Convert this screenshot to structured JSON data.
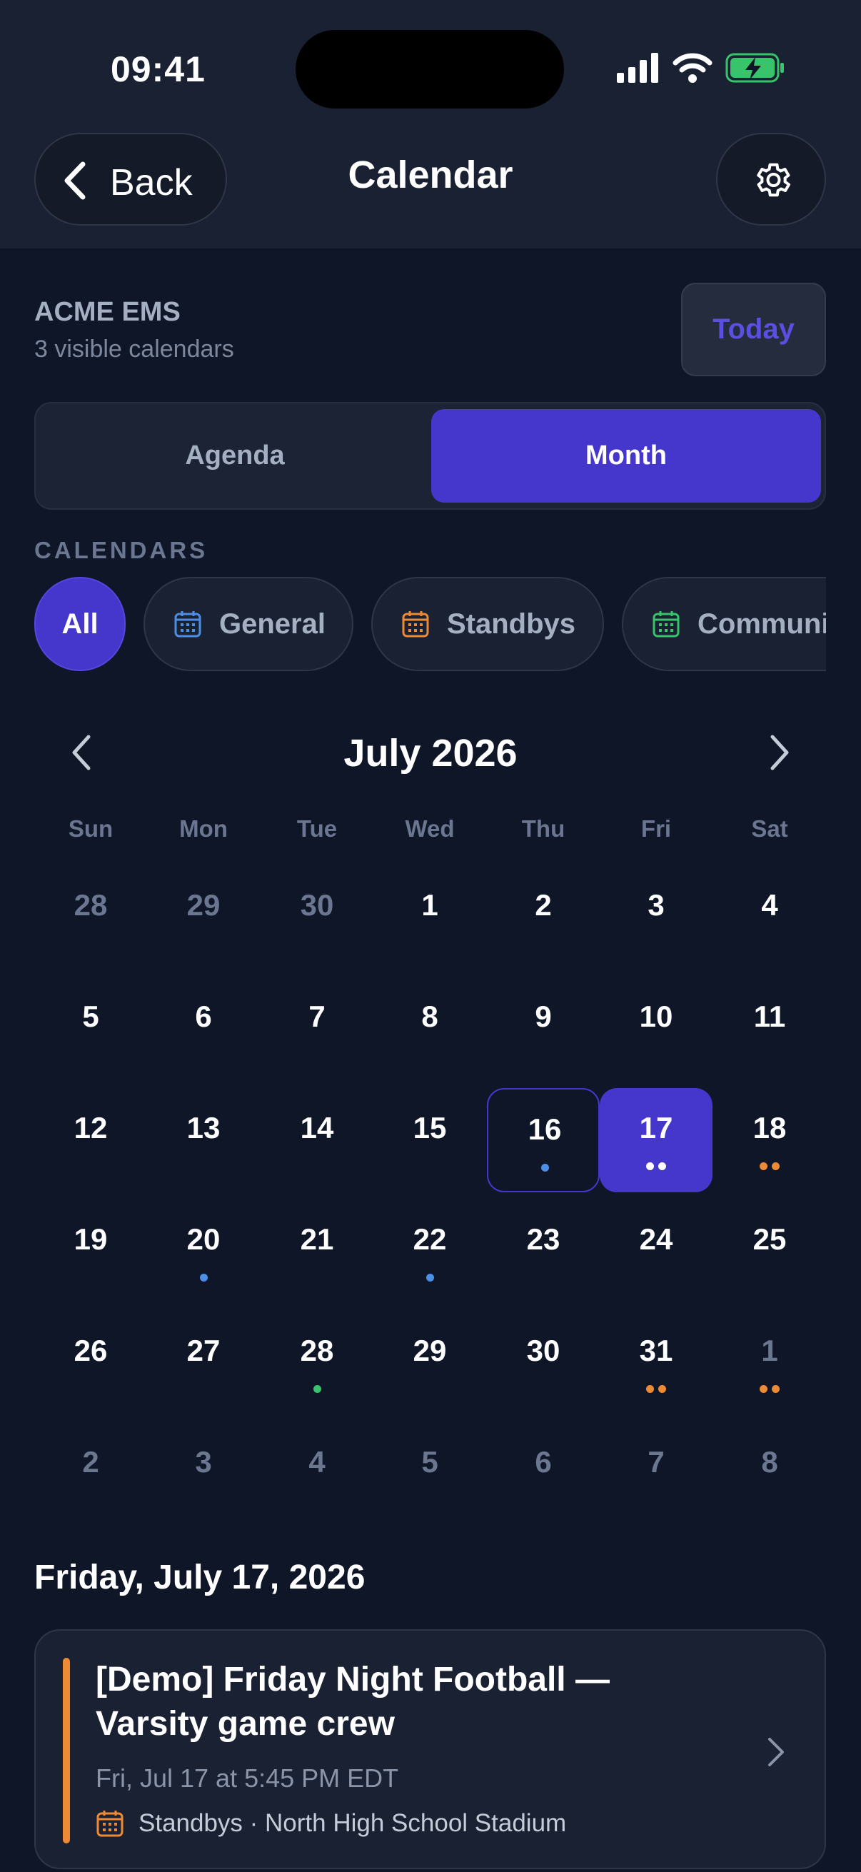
{
  "status": {
    "time": "09:41"
  },
  "nav": {
    "back_label": "Back",
    "title": "Calendar"
  },
  "org": {
    "name": "ACME EMS",
    "subtitle": "3 visible calendars",
    "today_label": "Today"
  },
  "segments": {
    "agenda": "Agenda",
    "month": "Month",
    "selected": "Month"
  },
  "calendars": {
    "heading": "CALENDARS",
    "chips": [
      {
        "label": "All",
        "selected": true
      },
      {
        "label": "General",
        "color": "#4e8fe6",
        "icon": "calendar-icon"
      },
      {
        "label": "Standbys",
        "color": "#ed8a35",
        "icon": "calendar-icon"
      },
      {
        "label": "Community",
        "color": "#38c46a",
        "icon": "calendar-icon"
      }
    ]
  },
  "month": {
    "title": "July 2026",
    "weekdays": [
      "Sun",
      "Mon",
      "Tue",
      "Wed",
      "Thu",
      "Fri",
      "Sat"
    ],
    "weeks": [
      [
        {
          "d": "28",
          "m": true
        },
        {
          "d": "29",
          "m": true
        },
        {
          "d": "30",
          "m": true
        },
        {
          "d": "1"
        },
        {
          "d": "2"
        },
        {
          "d": "3"
        },
        {
          "d": "4"
        }
      ],
      [
        {
          "d": "5"
        },
        {
          "d": "6"
        },
        {
          "d": "7"
        },
        {
          "d": "8"
        },
        {
          "d": "9"
        },
        {
          "d": "10"
        },
        {
          "d": "11"
        }
      ],
      [
        {
          "d": "12"
        },
        {
          "d": "13"
        },
        {
          "d": "14"
        },
        {
          "d": "15"
        },
        {
          "d": "16",
          "today": true,
          "dots": [
            "#4e8fe6"
          ]
        },
        {
          "d": "17",
          "selected": true,
          "dots": [
            "#ffffff",
            "#ffffff"
          ]
        },
        {
          "d": "18",
          "dots": [
            "#ed8a35",
            "#ed8a35"
          ]
        }
      ],
      [
        {
          "d": "19"
        },
        {
          "d": "20",
          "dots": [
            "#4e8fe6"
          ]
        },
        {
          "d": "21"
        },
        {
          "d": "22",
          "dots": [
            "#4e8fe6"
          ]
        },
        {
          "d": "23"
        },
        {
          "d": "24"
        },
        {
          "d": "25"
        }
      ],
      [
        {
          "d": "26"
        },
        {
          "d": "27"
        },
        {
          "d": "28",
          "dots": [
            "#38c46a"
          ]
        },
        {
          "d": "29"
        },
        {
          "d": "30"
        },
        {
          "d": "31",
          "dots": [
            "#ed8a35",
            "#ed8a35"
          ]
        },
        {
          "d": "1",
          "m": true,
          "dots": [
            "#ed8a35",
            "#ed8a35"
          ]
        }
      ],
      [
        {
          "d": "2",
          "m": true
        },
        {
          "d": "3",
          "m": true
        },
        {
          "d": "4",
          "m": true
        },
        {
          "d": "5",
          "m": true
        },
        {
          "d": "6",
          "m": true
        },
        {
          "d": "7",
          "m": true
        },
        {
          "d": "8",
          "m": true
        }
      ]
    ]
  },
  "selected_day": {
    "title": "Friday, July 17, 2026",
    "event": {
      "title": "[Demo] Friday Night Football — Varsity game crew",
      "time": "Fri, Jul 17 at 5:45 PM EDT",
      "meta": "Standbys · North High School Stadium",
      "color": "#ed8a35"
    }
  }
}
